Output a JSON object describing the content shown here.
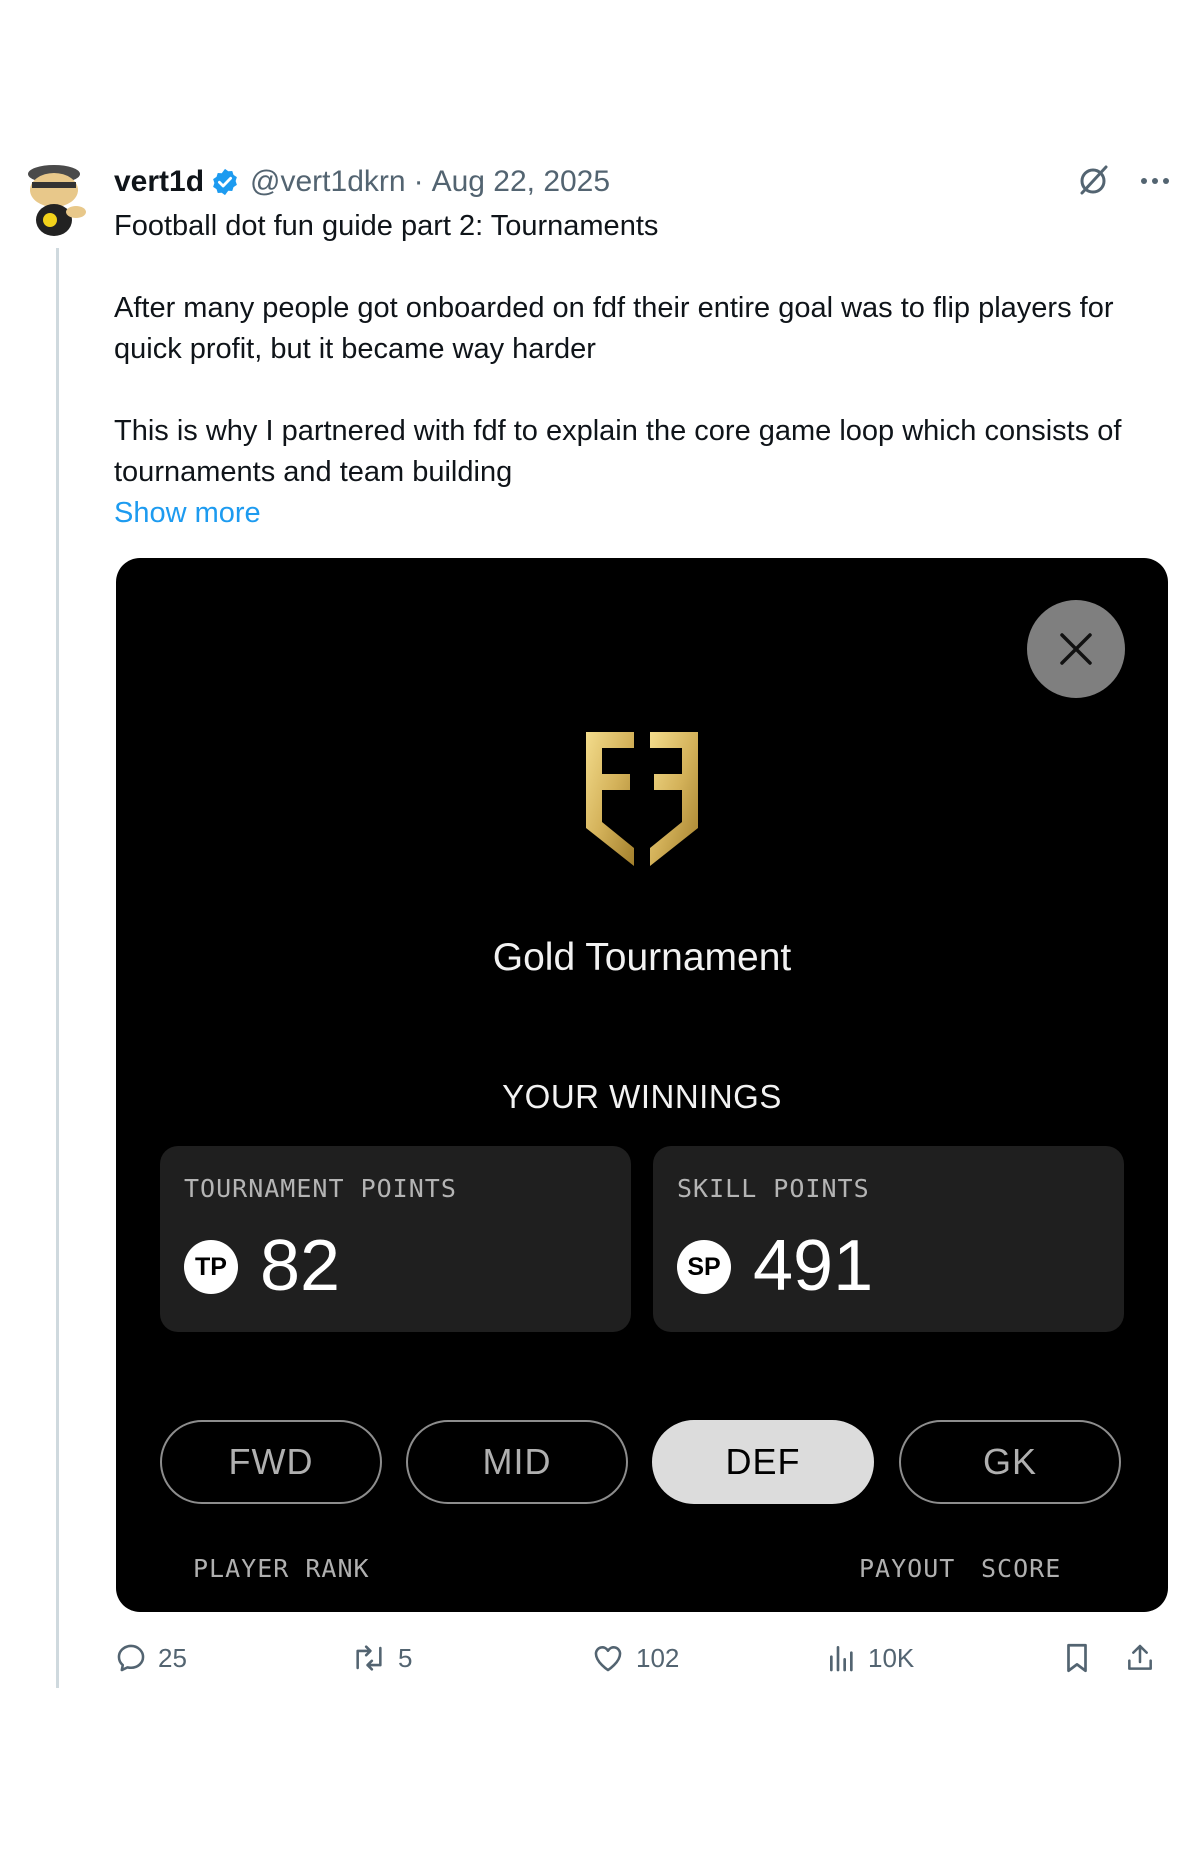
{
  "author": {
    "display_name": "vert1d",
    "handle": "@vert1dkrn",
    "separator": "·",
    "date": "Aug 22, 2025",
    "verified": true,
    "verified_color": "#1d9bf0"
  },
  "tweet": {
    "line1": "Football dot fun guide part 2: Tournaments",
    "para2": "After many people got onboarded on fdf their entire goal was to flip players for quick profit, but it became way harder",
    "para3": "This is why I partnered with fdf to explain the core game loop which consists of tournaments and team building",
    "show_more": "Show more"
  },
  "card": {
    "title": "Gold Tournament",
    "winnings_label": "YOUR WINNINGS",
    "stats": [
      {
        "label": "TOURNAMENT POINTS",
        "badge": "TP",
        "value": "82"
      },
      {
        "label": "SKILL POINTS",
        "badge": "SP",
        "value": "491"
      }
    ],
    "positions": [
      "FWD",
      "MID",
      "DEF",
      "GK"
    ],
    "active_position": "DEF",
    "columns": {
      "player_rank": "PLAYER RANK",
      "payout": "PAYOUT",
      "score": "SCORE"
    },
    "logo_color": "#d4b25a"
  },
  "actions": {
    "replies": "25",
    "reposts": "5",
    "likes": "102",
    "views": "10K"
  }
}
